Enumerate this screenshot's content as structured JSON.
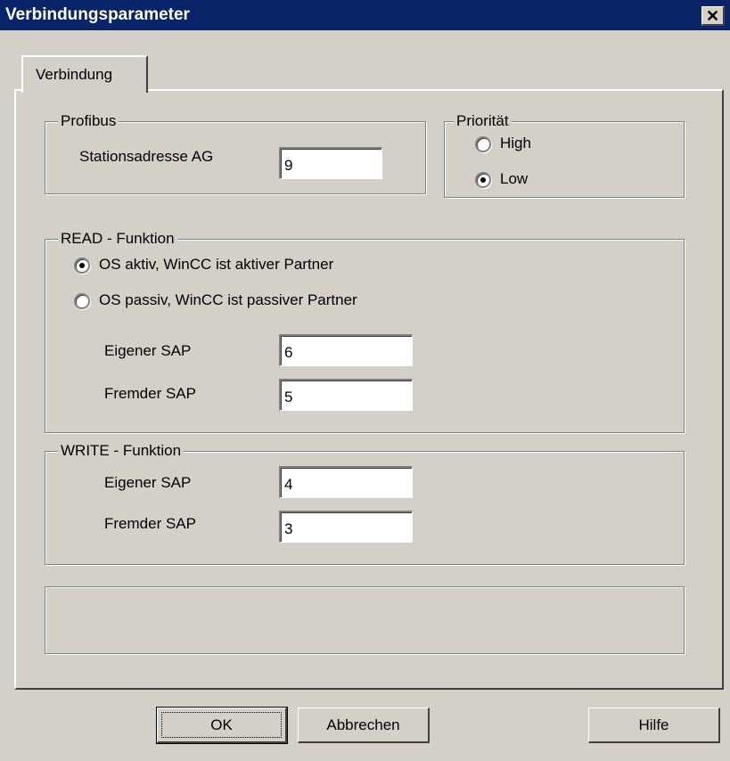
{
  "window": {
    "title": "Verbindungsparameter",
    "close_glyph": "✕"
  },
  "tabs": [
    {
      "label": "Verbindung",
      "active": true
    }
  ],
  "profibus": {
    "legend": "Profibus",
    "station_label": "Stationsadresse AG",
    "station_value": "9"
  },
  "priority": {
    "legend": "Priorität",
    "options": [
      {
        "label": "High",
        "checked": false
      },
      {
        "label": "Low",
        "checked": true
      }
    ]
  },
  "read": {
    "legend": "READ - Funktion",
    "options": [
      {
        "label": "OS aktiv, WinCC ist aktiver Partner",
        "checked": true
      },
      {
        "label": "OS passiv, WinCC ist passiver Partner",
        "checked": false
      }
    ],
    "own_sap_label": "Eigener SAP",
    "own_sap_value": "6",
    "foreign_sap_label": "Fremder SAP",
    "foreign_sap_value": "5"
  },
  "write": {
    "legend": "WRITE - Funktion",
    "own_sap_label": "Eigener SAP",
    "own_sap_value": "4",
    "foreign_sap_label": "Fremder SAP",
    "foreign_sap_value": "3"
  },
  "buttons": {
    "ok": "OK",
    "cancel": "Abbrechen",
    "help": "Hilfe"
  },
  "colors": {
    "titlebar": "#0a246a",
    "face": "#d4d0c8"
  }
}
